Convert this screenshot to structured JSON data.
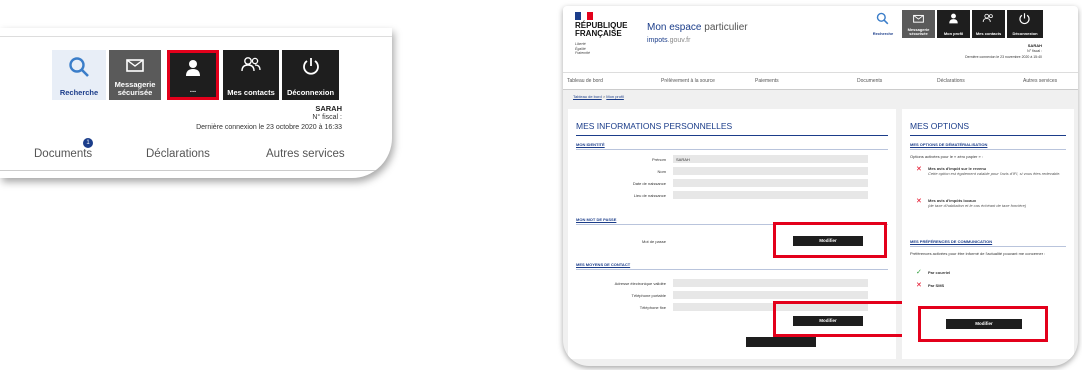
{
  "left_zoom": {
    "toolbar": {
      "search_label": "Recherche",
      "messaging_label": "Messagerie sécurisée",
      "profile_label": "...",
      "contacts_label": "Mes contacts",
      "logout_label": "Déconnexion"
    },
    "user_name": "SARAH",
    "fiscal_number": "N° fiscal :",
    "last_login": "Dernière connexion le 23 octobre 2020 à 16:33",
    "notification_count": "1",
    "nav": [
      "Documents",
      "Déclarations",
      "Autres services"
    ]
  },
  "site": {
    "rf_title_line1": "RÉPUBLIQUE",
    "rf_title_line2": "FRANÇAISE",
    "rf_motto": [
      "Liberté",
      "Égalité",
      "Fraternité"
    ],
    "title_bold": "Mon espace",
    "title_rest": "particulier",
    "subtitle_main": "impots",
    "subtitle_domain": ".gouv.fr",
    "toolbar": {
      "search_label": "Recherche",
      "messaging_label": "Messagerie sécurisée",
      "profile_label": "Mon profil",
      "contacts_label": "Mes contacts",
      "logout_label": "Déconnexion"
    },
    "user_name": "SARAH",
    "fiscal_number": "N° fiscal :",
    "last_login": "Dernière connexion le 23 novembre 2020 à 15:40",
    "nav": [
      "Tableau de bord",
      "Prélèvement à la source",
      "Paiements",
      "Documents",
      "Déclarations",
      "Autres services"
    ],
    "breadcrumb": {
      "home": "Tableau de bord",
      "separator": ">",
      "current": "Mon profil"
    }
  },
  "info_panel": {
    "title": "MES INFORMATIONS PERSONNELLES",
    "identity_section": "MON IDENTITÉ",
    "identity_fields": [
      {
        "label": "Prénom",
        "value": "SARAH"
      },
      {
        "label": "Nom",
        "value": ""
      },
      {
        "label": "Date de naissance",
        "value": ""
      },
      {
        "label": "Lieu de naissance",
        "value": ""
      }
    ],
    "password_section": "MON MOT DE PASSE",
    "password_label": "Mot de passe",
    "password_button": "Modifier",
    "contact_section": "MES MOYENS DE CONTACT",
    "contact_fields": [
      {
        "label": "Adresse électronique validée",
        "value": ""
      },
      {
        "label": "Téléphone portable",
        "value": ""
      },
      {
        "label": "Téléphone fixe",
        "value": ""
      }
    ],
    "contact_button": "Modifier"
  },
  "options_panel": {
    "title": "MES OPTIONS",
    "paperless_section": "MES OPTIONS DE DÉMATÉRIALISATION",
    "paperless_intro": "Options activées pour le « zéro papier » :",
    "paperless_items": [
      {
        "title": "Mes avis d'impôt sur le revenu",
        "detail": "Cette option est également valable pour l'avis d'IFI, si vous êtes redevable."
      },
      {
        "title": "Mes avis d'impôts locaux",
        "detail": "(de taxe d'habitation et le cas échéant de taxe foncière)"
      }
    ],
    "comm_section": "MES PRÉFÉRENCES DE COMMUNICATION",
    "comm_intro": "Préférences activées pour être informé de l'actualité pouvant me concerner :",
    "comm_items": [
      "Par courriel",
      "Par SMS"
    ],
    "button": "Modifier"
  },
  "colors": {
    "accent_blue": "#1b3d8a",
    "highlight_red": "#e3001b",
    "button_dark": "#1e1e1e"
  }
}
